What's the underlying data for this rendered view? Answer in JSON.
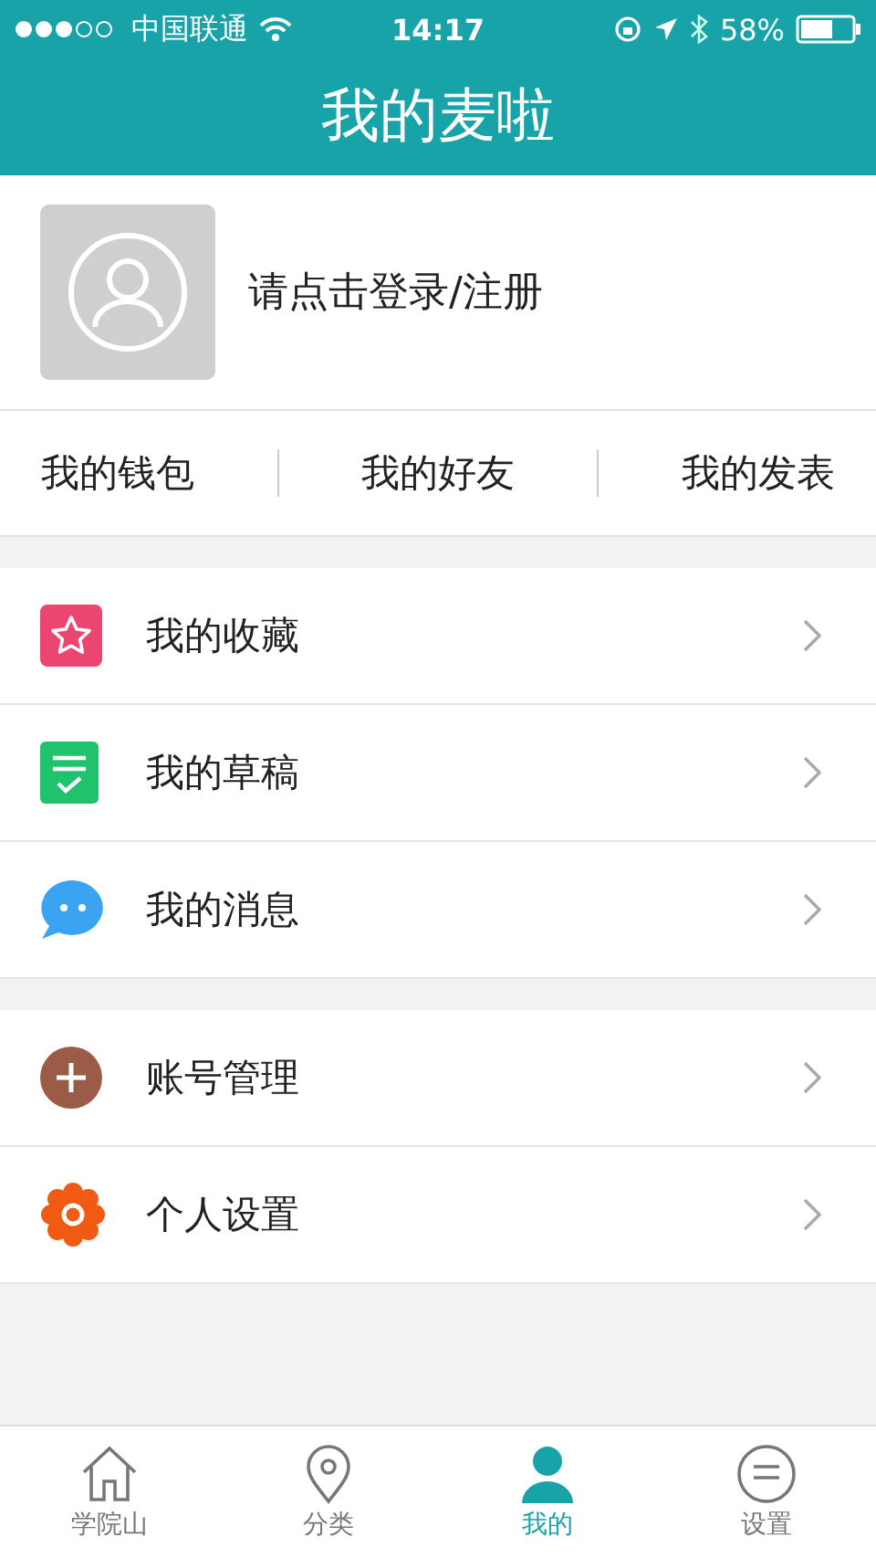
{
  "status_bar": {
    "carrier": "中国联通",
    "time": "14:17",
    "battery": "58%"
  },
  "header": {
    "title": "我的麦啦"
  },
  "profile": {
    "login_text": "请点击登录/注册"
  },
  "quick_links": [
    "我的钱包",
    "我的好友",
    "我的发表"
  ],
  "menu_groups": [
    [
      {
        "kind": "star",
        "label": "我的收藏"
      },
      {
        "kind": "draft",
        "label": "我的草稿"
      },
      {
        "kind": "message",
        "label": "我的消息"
      }
    ],
    [
      {
        "kind": "plus",
        "label": "账号管理"
      },
      {
        "kind": "gear",
        "label": "个人设置"
      }
    ]
  ],
  "tab_bar": [
    {
      "kind": "home",
      "label": "学院山",
      "selected": false
    },
    {
      "kind": "pin",
      "label": "分类",
      "selected": false
    },
    {
      "kind": "person",
      "label": "我的",
      "selected": true
    },
    {
      "kind": "chat",
      "label": "设置",
      "selected": false
    }
  ]
}
